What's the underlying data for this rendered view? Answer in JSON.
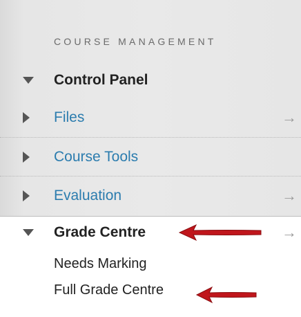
{
  "section": {
    "heading": "COURSE MANAGEMENT"
  },
  "control_panel": {
    "label": "Control Panel",
    "items": [
      {
        "label": "Files",
        "has_arrow": true,
        "arrow": "→"
      },
      {
        "label": "Course Tools",
        "has_arrow": false,
        "arrow": ""
      },
      {
        "label": "Evaluation",
        "has_arrow": true,
        "arrow": "→"
      }
    ]
  },
  "grade_centre": {
    "label": "Grade Centre",
    "arrow": "→",
    "subitems": [
      {
        "label": "Needs Marking"
      },
      {
        "label": "Full Grade Centre"
      }
    ]
  },
  "colors": {
    "link": "#2b7cae",
    "annotation_arrow": "#c0161c",
    "panel_bg": "#e9e9e9"
  }
}
